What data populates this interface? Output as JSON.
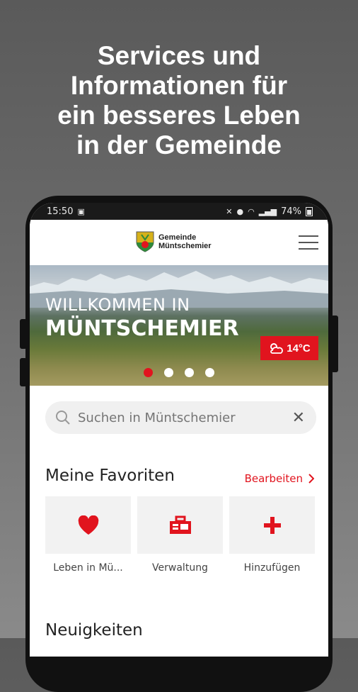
{
  "promo": {
    "headline_lines": [
      "Services und",
      "Informationen für",
      "ein besseres Leben",
      "in der Gemeinde"
    ]
  },
  "statusbar": {
    "time": "15:50",
    "battery": "74%"
  },
  "app": {
    "logo_line1": "Gemeinde",
    "logo_line2": "Müntschemier"
  },
  "hero": {
    "welcome": "WILLKOMMEN IN",
    "town": "MÜNTSCHEMIER",
    "temperature": "14°C",
    "slides_total": 4,
    "slide_active": 1
  },
  "search": {
    "placeholder": "Suchen in Müntschemier",
    "value": ""
  },
  "favorites": {
    "title": "Meine Favoriten",
    "edit_label": "Bearbeiten",
    "items": [
      {
        "label": "Leben in Mü...",
        "icon": "heart-icon"
      },
      {
        "label": "Verwaltung",
        "icon": "administration-icon"
      },
      {
        "label": "Hinzufügen",
        "icon": "plus-icon"
      }
    ]
  },
  "news": {
    "title": "Neuigkeiten"
  },
  "colors": {
    "accent": "#e1141e",
    "text": "#222222",
    "tile_bg": "#f2f2f2"
  }
}
